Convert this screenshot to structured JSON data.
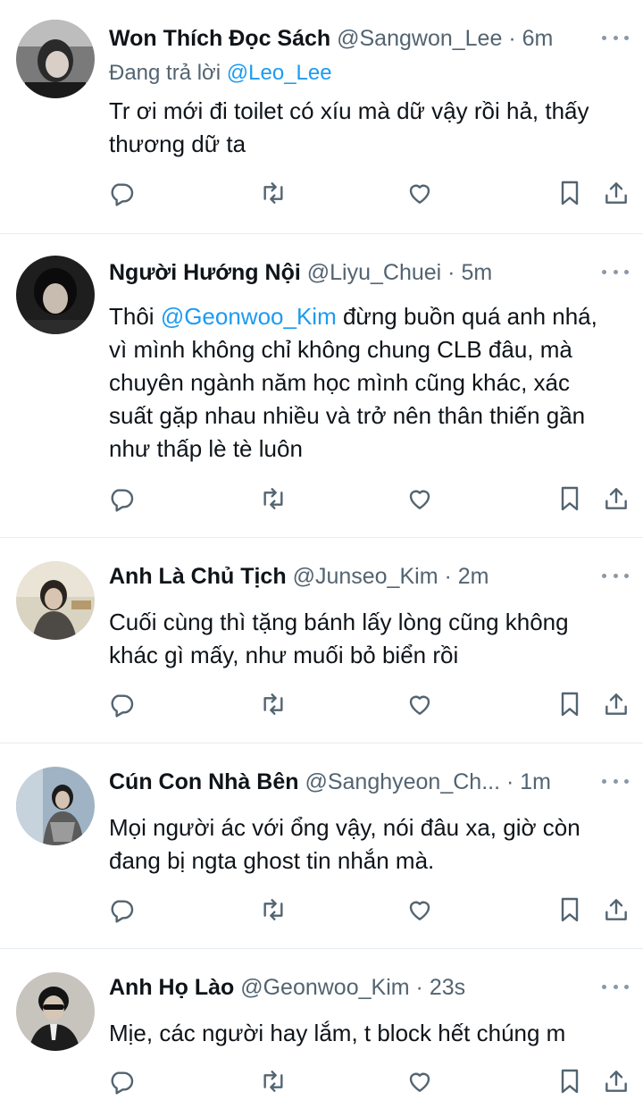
{
  "tweets": [
    {
      "display_name": "Won Thích Đọc Sách",
      "handle": "@Sangwon_Lee",
      "separator": "·",
      "time": "6m",
      "replying_prefix": "Đang trả lời",
      "replying_to": "@Leo_Lee",
      "text_lines": [
        "Tr ơi mới đi toilet có xíu mà dữ vậy rồi hả, thấy",
        "thương dữ ta"
      ]
    },
    {
      "display_name": "Người Hướng Nội",
      "handle": "@Liyu_Chuei",
      "separator": "·",
      "time": "5m",
      "mention": "@Geonwoo_Kim",
      "text_first_prefix": "Thôi ",
      "text_first_suffix": " đừng buồn quá anh nhá,",
      "text_lines": [
        "vì mình không chỉ không chung CLB đâu, mà",
        "chuyên ngành năm học mình cũng khác, xác",
        "suất gặp nhau nhiều và trở nên thân thiến gần",
        "như thấp lè tè luôn"
      ]
    },
    {
      "display_name": "Anh Là Chủ Tịch",
      "handle": "@Junseo_Kim",
      "separator": "·",
      "time": "2m",
      "text_lines": [
        "Cuối cùng thì tặng bánh lấy lòng cũng không",
        "khác gì mấy, như muối bỏ biển rồi"
      ]
    },
    {
      "display_name": "Cún Con Nhà Bên",
      "handle": "@Sanghyeon_Ch...",
      "separator": "·",
      "time": "1m",
      "text_lines": [
        "Mọi người ác với ổng vậy, nói đâu xa, giờ còn",
        "đang bị ngta ghost tin nhắn mà."
      ]
    },
    {
      "display_name": "Anh Họ Lào",
      "handle": "@Geonwoo_Kim",
      "separator": "·",
      "time": "23s",
      "text_lines": [
        "Mịe, các người hay lắm, t block hết chúng m"
      ]
    }
  ],
  "icons": {
    "reply": "reply-icon",
    "retweet": "retweet-icon",
    "like": "heart-icon",
    "bookmark": "bookmark-icon",
    "share": "share-icon",
    "more": "more-icon"
  },
  "colors": {
    "accent": "#1d9bf0",
    "text": "#0f1419",
    "secondary": "#536471",
    "divider": "#e6ecf0"
  }
}
